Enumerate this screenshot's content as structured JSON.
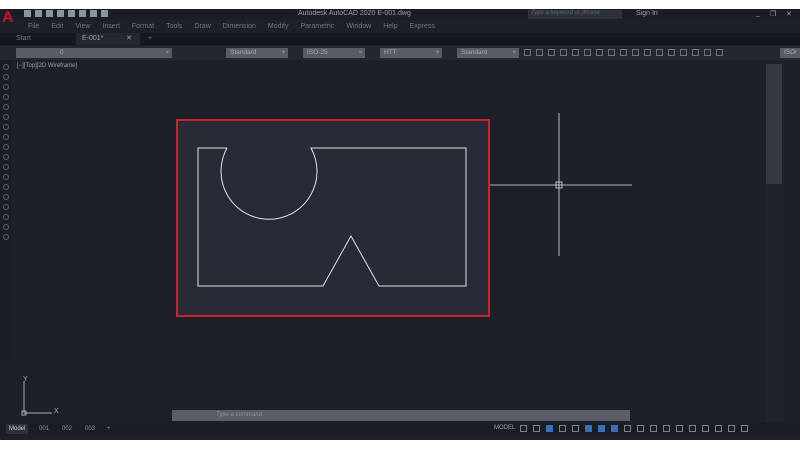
{
  "app": {
    "logo": "A",
    "title": "Autodesk AutoCAD 2020    E-001.dwg",
    "search_placeholder": "Type a keyword or phrase",
    "sign_in": "Sign In",
    "minimize": "_",
    "restore": "❐",
    "close": "✕"
  },
  "menu": [
    "File",
    "Edit",
    "View",
    "Insert",
    "Format",
    "Tools",
    "Draw",
    "Dimension",
    "Modify",
    "Parametric",
    "Window",
    "Help",
    "Express"
  ],
  "tabs": {
    "start": "Start",
    "file": "E-001*",
    "close": "✕",
    "new": "+"
  },
  "toolbar": {
    "layer": "0",
    "text_style": "Standard",
    "dim_style": "ISO-25",
    "table_style": "HTT",
    "mleader_style": "Standard",
    "right_style": "ISO"
  },
  "viewport": {
    "label": "[−][Top][2D Wireframe]",
    "ucs_x": "X",
    "ucs_y": "Y"
  },
  "command": {
    "placeholder": "Type a command"
  },
  "layout_tabs": [
    "Model",
    "001",
    "002",
    "003",
    "+"
  ],
  "status": {
    "model": "MODEL"
  },
  "colors": {
    "selection": "#d0202a",
    "geometry": "#e0e3e8",
    "background": "#1c2029"
  }
}
